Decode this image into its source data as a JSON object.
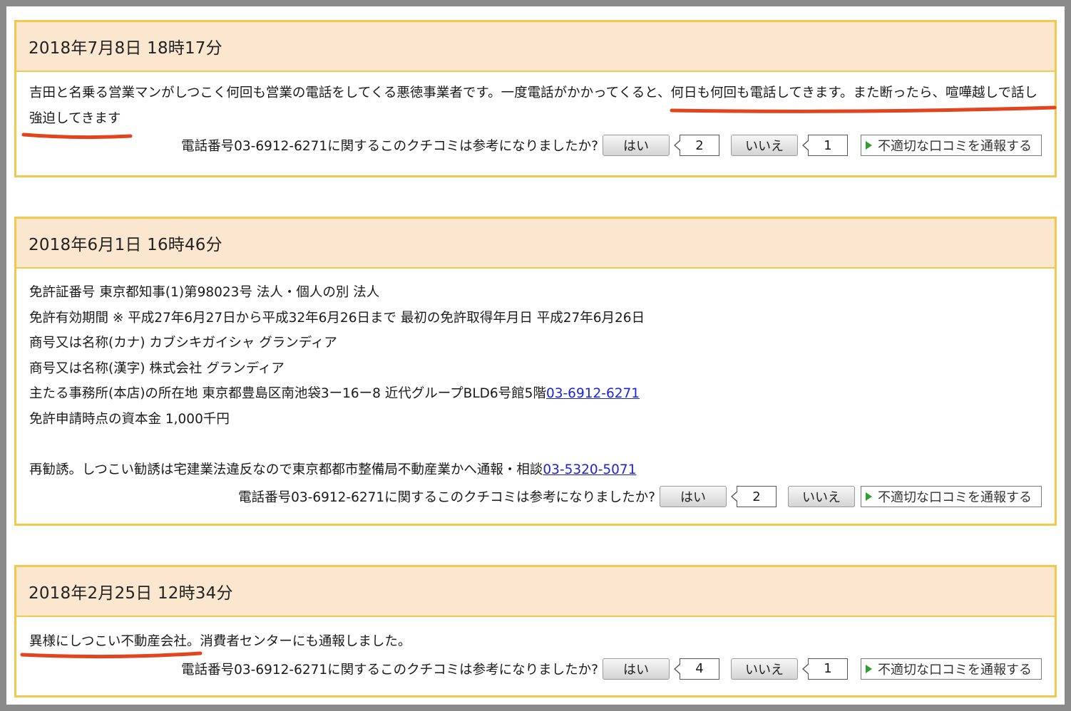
{
  "vote": {
    "question": "電話番号03-6912-6271に関するこのクチコミは参考になりましたか?",
    "yes_label": "はい",
    "no_label": "いいえ",
    "report_label": "不適切な口コミを通報する"
  },
  "reviews": [
    {
      "date": "2018年7月8日 18時17分",
      "text_a": "吉田と名乗る営業マンがしつこく何回も営業の電話をしてくる悪徳事業者です。一度電話がかかってくると、",
      "text_b": "何日も何回も電話してきます。また断ったら、喧嘩越しで話し",
      "text_c": "強迫してきます",
      "yes_count": "2",
      "no_count": "1"
    },
    {
      "date": "2018年6月1日 16時46分",
      "lines": [
        "免許証番号 東京都知事(1)第98023号 法人・個人の別 法人",
        "免許有効期間 ※ 平成27年6月27日から平成32年6月26日まで 最初の免許取得年月日 平成27年6月26日",
        "商号又は名称(カナ) カブシキガイシャ グランディア",
        "商号又は名称(漢字) 株式会社 グランディア",
        "主たる事務所(本店)の所在地 東京都豊島区南池袋3ー16ー8 近代グループBLD6号館5階",
        "免許申請時点の資本金 1,000千円"
      ],
      "link_1": "03-6912-6271",
      "extra_line": "再勧誘。しつこい勧誘は宅建業法違反なので東京都都市整備局不動産業かへ通報・相談",
      "link_2": "03-5320-5071",
      "yes_count": "2"
    },
    {
      "date": "2018年2月25日 12時34分",
      "text_a": "異様にしつこい不動産会社",
      "text_b": "。消費者センターにも通報しました。",
      "yes_count": "4",
      "no_count": "1"
    }
  ],
  "colors": {
    "card_border": "#f2c94c",
    "header_bg": "#fbe7cf",
    "link": "#1a24d6",
    "annotation": "#e0451f"
  }
}
